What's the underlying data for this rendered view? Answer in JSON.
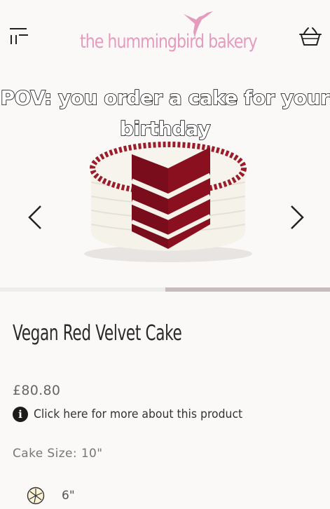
{
  "header": {
    "brand": "the hummingbird bakery",
    "menu_icon": "hamburger-menu-icon",
    "logo_icon": "hummingbird-logo-icon",
    "basket_icon": "basket-icon",
    "brand_color": "#e59bbd"
  },
  "overlay": {
    "caption": "POV: you order a cake for your birthday"
  },
  "gallery": {
    "image_alt": "red velvet cake slice image",
    "prev_icon": "chevron-left-icon",
    "next_icon": "chevron-right-icon",
    "progress": 0.5
  },
  "product": {
    "title": "Vegan Red Velvet Cake",
    "price": "£80.80",
    "info_icon": "info-icon",
    "info_glyph": "i",
    "info_link": "Click here for more about this product",
    "size_label": "Cake Size: 10\"",
    "size_options": [
      {
        "icon": "cake-size-icon",
        "label": "6\""
      }
    ]
  }
}
